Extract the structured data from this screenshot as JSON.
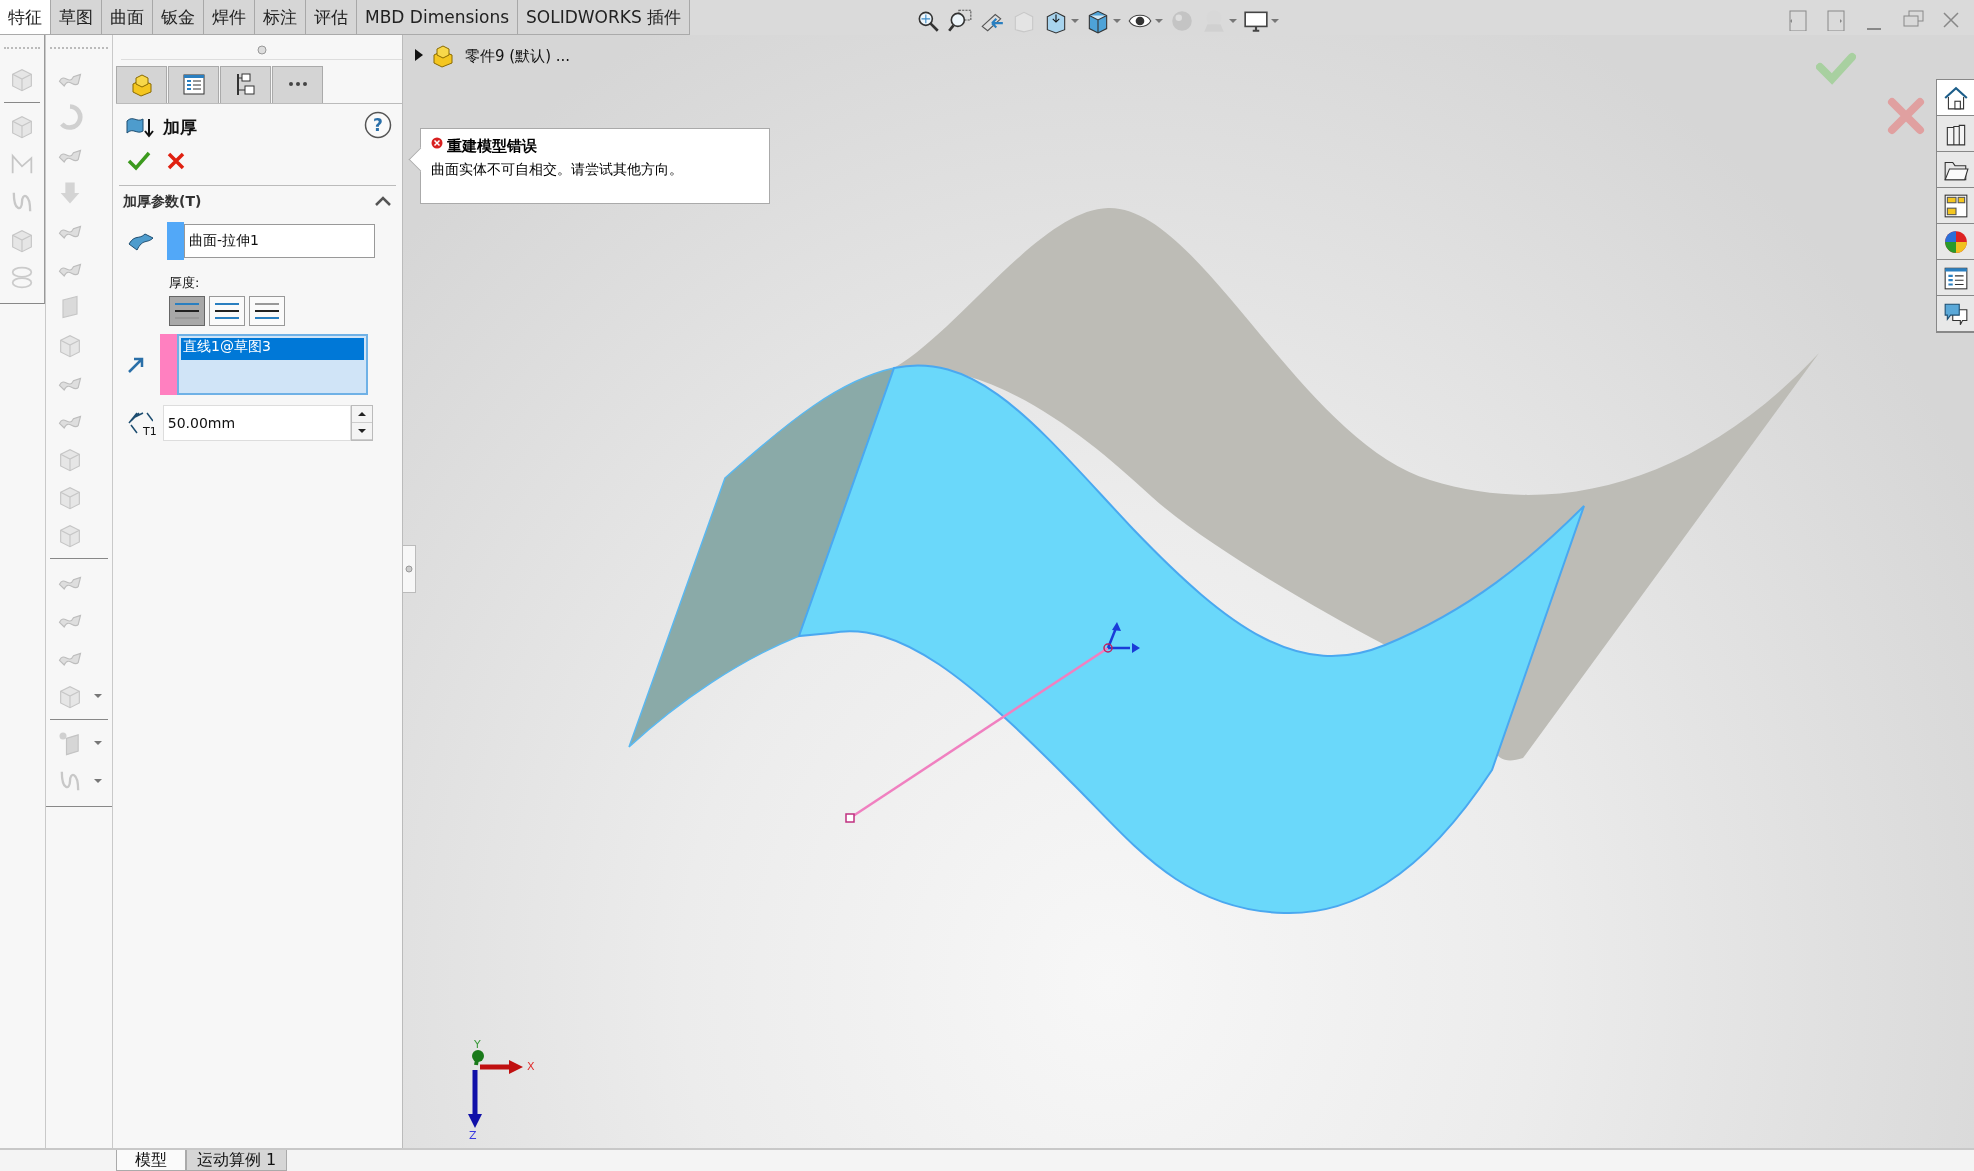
{
  "command_tabs": [
    {
      "label": "特征",
      "selected": true
    },
    {
      "label": "草图",
      "selected": false
    },
    {
      "label": "曲面",
      "selected": false
    },
    {
      "label": "钣金",
      "selected": false
    },
    {
      "label": "焊件",
      "selected": false
    },
    {
      "label": "标注",
      "selected": false
    },
    {
      "label": "评估",
      "selected": false
    },
    {
      "label": "MBD Dimensions",
      "selected": false
    },
    {
      "label": "SOLIDWORKS 插件",
      "selected": false
    }
  ],
  "property_manager": {
    "title": "加厚",
    "section": {
      "title": "加厚参数(T)",
      "expanded": true
    },
    "surface_field": {
      "value": "曲面-拉伸1"
    },
    "thickness_label": "厚度:",
    "thickness_sides": [
      {
        "selected": true
      },
      {
        "selected": false
      },
      {
        "selected": false
      }
    ],
    "direction_list": [
      {
        "label": "直线1@草图3",
        "selected": true
      }
    ],
    "thickness_icon_label": "T1",
    "thickness_field": {
      "value": "50.00mm"
    }
  },
  "help_label": "?",
  "task_pane_tabs": [
    {
      "selected": true
    },
    {
      "selected": false
    },
    {
      "selected": false
    },
    {
      "selected": false
    },
    {
      "selected": false
    },
    {
      "selected": false
    },
    {
      "selected": false
    }
  ],
  "feature_tree": {
    "part": "零件9 (默认) ...",
    "expanded": false
  },
  "error_tooltip": {
    "title": "重建模型错误",
    "message": "曲面实体不可自相交。请尝试其他方向。"
  },
  "triad": {
    "x": "X",
    "y": "Y",
    "z": "Z"
  },
  "bottom_tabs": [
    {
      "label": "模型",
      "selected": true
    },
    {
      "label": "运动算例 1",
      "selected": false
    }
  ]
}
